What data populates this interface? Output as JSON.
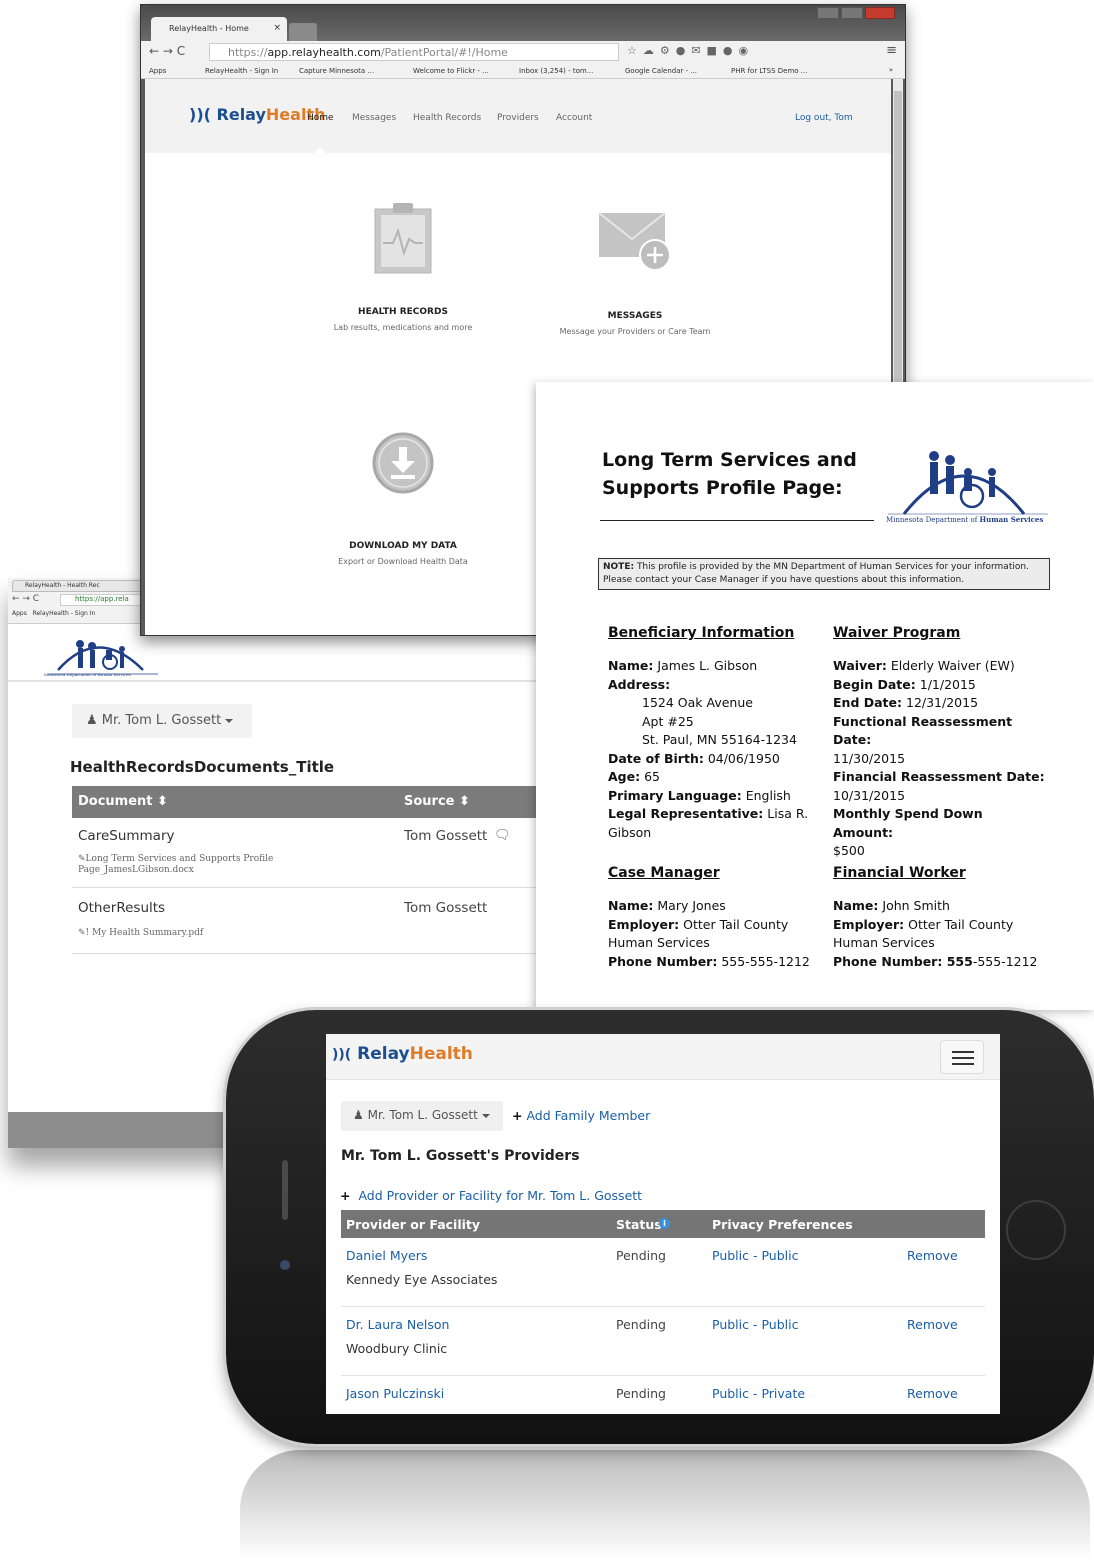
{
  "back_window": {
    "tab_title": "RelayHealth - Health Rec",
    "url": "https://app.rela",
    "bookmarks": [
      "Apps",
      "RelayHealth - Sign In"
    ],
    "user_menu_label": "Mr. Tom L. Gossett",
    "page_title": "HealthRecordsDocuments_Title",
    "table": {
      "headers": [
        "Document ⬍",
        "Source ⬍"
      ],
      "rows": [
        {
          "document": "CareSummary",
          "attachment": "Long Term Services and Supports Profile Page_JamesLGibson.docx",
          "source": "Tom Gossett"
        },
        {
          "document": "OtherResults",
          "attachment": "! My Health Summary.pdf",
          "source": "Tom Gossett"
        }
      ]
    },
    "logo_caption": "Minnesota Department of Human Services"
  },
  "front_window": {
    "tab_title": "RelayHealth - Home",
    "url_prefix": "https://",
    "url_host": "app.relayhealth.com",
    "url_path": "/PatientPortal/#!/Home",
    "bookmarks": [
      "Apps",
      "RelayHealth - Sign In",
      "Capture Minnesota ...",
      "Welcome to Flickr - ...",
      "Inbox (3,254) - tom...",
      "Google Calendar - ...",
      "PHR for LTSS Demo ..."
    ],
    "brand": {
      "part1": "Relay",
      "part2": "Health"
    },
    "nav": [
      "Home",
      "Messages",
      "Health Records",
      "Providers",
      "Account"
    ],
    "logout": "Log out, Tom",
    "tiles": [
      {
        "title": "HEALTH RECORDS",
        "subtitle": "Lab results, medications and more"
      },
      {
        "title": "MESSAGES",
        "subtitle": "Message your Providers or Care Team"
      },
      {
        "title": "DOWNLOAD MY DATA",
        "subtitle": "Export or Download Health Data"
      }
    ]
  },
  "profile": {
    "title_line1": "Long Term Services and",
    "title_line2": "Supports Profile Page:",
    "logo_caption_a": "Minnesota Department of ",
    "logo_caption_b": "Human Services",
    "note_label": "NOTE:",
    "note_text": " This profile is provided by the MN Department of Human Services for your information. Please contact your Case Manager if you have questions about this information.",
    "beneficiary": {
      "heading": "Beneficiary Information",
      "name_label": "Name:",
      "name": " James L. Gibson",
      "address_label": "Address:",
      "address_lines": [
        "1524 Oak Avenue",
        "Apt #25",
        "St. Paul, MN 55164-1234"
      ],
      "dob_label": "Date of Birth:",
      "dob": " 04/06/1950",
      "age_label": "Age:",
      "age": " 65",
      "lang_label": "Primary Language:",
      "lang": " English",
      "rep_label": "Legal Representative:",
      "rep": " Lisa R. Gibson"
    },
    "waiver": {
      "heading": "Waiver Program",
      "waiver_label": "Waiver:",
      "waiver": " Elderly Waiver (EW)",
      "begin_label": "Begin Date:",
      "begin": " 1/1/2015",
      "end_label": "End Date:",
      "end": " 12/31/2015",
      "func_label": "Functional Reassessment Date:",
      "func": "11/30/2015",
      "fin_label": "Financial Reassessment Date:",
      "fin": "10/31/2015",
      "spend_label": "Monthly Spend Down Amount:",
      "spend": "$500"
    },
    "case_manager": {
      "heading": "Case Manager",
      "name_label": "Name:",
      "name": " Mary Jones",
      "employer_label": "Employer:",
      "employer": " Otter Tail County Human Services",
      "phone_label": "Phone Number:",
      "phone": " 555-555-1212"
    },
    "financial_worker": {
      "heading": "Financial Worker",
      "name_label": "Name:",
      "name": " John Smith",
      "employer_label": "Employer:",
      "employer": " Otter Tail County Human Services",
      "phone_label": "Phone Number:",
      "phone_bold": " 555",
      "phone": "-555-1212"
    }
  },
  "phone": {
    "brand": {
      "part1": "Relay",
      "part2": "Health"
    },
    "user_menu_label": "Mr. Tom L. Gossett",
    "add_family": "Add Family Member",
    "heading": "Mr. Tom L. Gossett's Providers",
    "add_provider": "Add Provider or Facility for Mr. Tom L. Gossett",
    "headers": [
      "Provider or Facility",
      "Status",
      "Privacy Preferences"
    ],
    "rows": [
      {
        "name": "Daniel Myers",
        "facility": "Kennedy Eye Associates",
        "status": "Pending",
        "privacy": "Public - Public",
        "action": "Remove"
      },
      {
        "name": "Dr. Laura Nelson",
        "facility": "Woodbury Clinic",
        "status": "Pending",
        "privacy": "Public - Public",
        "action": "Remove"
      },
      {
        "name": "Jason Pulczinski",
        "facility": "",
        "status": "Pending",
        "privacy": "Public - Private",
        "action": "Remove"
      }
    ]
  },
  "colors": {
    "relay_blue": "#1b4f8f",
    "health_orange": "#e07b26",
    "link_blue": "#1a5ea8",
    "table_header_grey": "#7b7b7b",
    "phone_header_grey": "#757575"
  }
}
